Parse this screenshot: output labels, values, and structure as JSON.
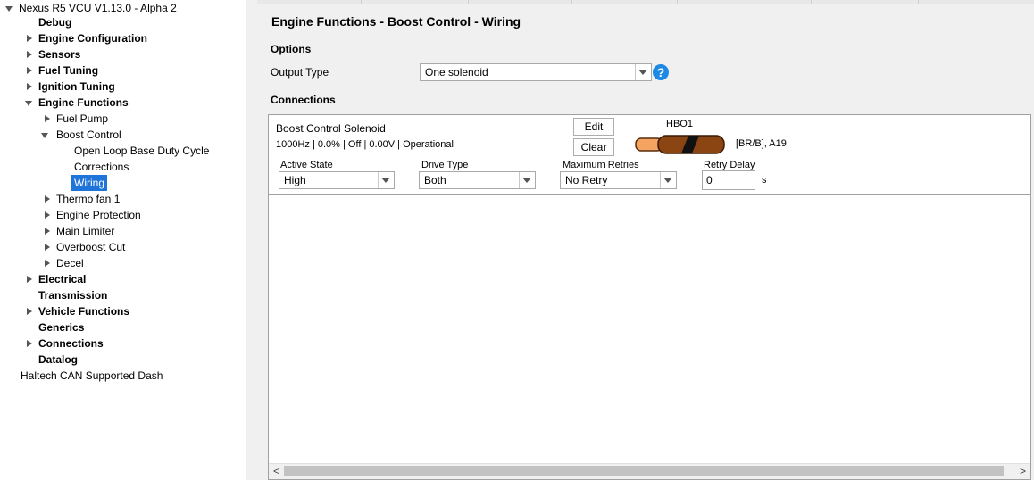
{
  "sidebar": {
    "root_label": "Nexus R5 VCU V1.13.0 - Alpha 2",
    "items": [
      {
        "label": "Debug"
      },
      {
        "label": "Engine Configuration"
      },
      {
        "label": "Sensors"
      },
      {
        "label": "Fuel Tuning"
      },
      {
        "label": "Ignition Tuning"
      },
      {
        "label": "Engine Functions"
      },
      {
        "label": "Fuel Pump"
      },
      {
        "label": "Boost Control"
      },
      {
        "label": "Open Loop Base Duty Cycle"
      },
      {
        "label": "Corrections"
      },
      {
        "label": "Wiring"
      },
      {
        "label": "Thermo fan 1"
      },
      {
        "label": "Engine Protection"
      },
      {
        "label": "Main Limiter"
      },
      {
        "label": "Overboost Cut"
      },
      {
        "label": "Decel"
      },
      {
        "label": "Electrical"
      },
      {
        "label": "Transmission"
      },
      {
        "label": "Vehicle Functions"
      },
      {
        "label": "Generics"
      },
      {
        "label": "Connections"
      },
      {
        "label": "Datalog"
      }
    ],
    "footer_label": "Haltech CAN Supported Dash"
  },
  "main": {
    "title": "Engine Functions - Boost Control - Wiring",
    "options_heading": "Options",
    "output_type_label": "Output Type",
    "output_type_value": "One solenoid",
    "help_glyph": "?",
    "connections_heading": "Connections",
    "connection": {
      "name": "Boost Control Solenoid",
      "status": "1000Hz | 0.0% | Off | 0.00V | Operational",
      "edit_label": "Edit",
      "clear_label": "Clear",
      "pin_name": "HBO1",
      "wire_info": "[BR/B], A19",
      "wire_colors": {
        "main": "#8b4513",
        "stripe": "#111111",
        "tip": "#f4a460"
      },
      "active_state_label": "Active State",
      "active_state_value": "High",
      "drive_type_label": "Drive Type",
      "drive_type_value": "Both",
      "max_retries_label": "Maximum Retries",
      "max_retries_value": "No Retry",
      "retry_delay_label": "Retry Delay",
      "retry_delay_value": "0",
      "retry_delay_unit": "s"
    },
    "scroll_left": "<",
    "scroll_right": ">"
  }
}
